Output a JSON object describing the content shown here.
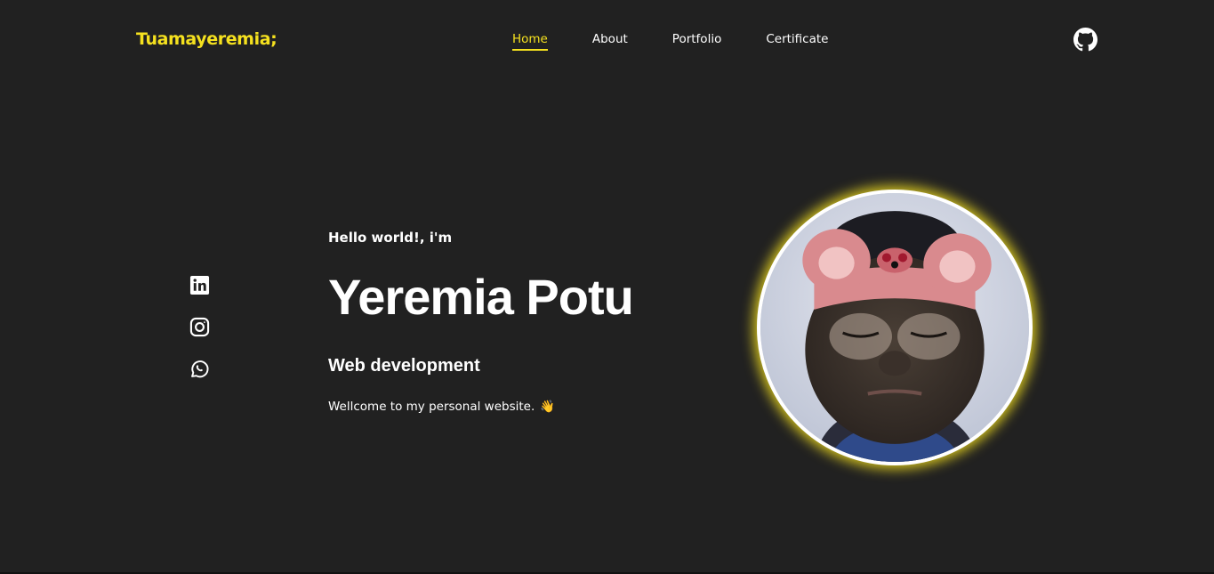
{
  "nav": {
    "brand": "Tuamayeremia;",
    "links": [
      {
        "label": "Home",
        "active": true
      },
      {
        "label": "About",
        "active": false
      },
      {
        "label": "Portfolio",
        "active": false
      },
      {
        "label": "Certificate",
        "active": false
      }
    ],
    "right_icon": "github-icon"
  },
  "socials": [
    "linkedin-icon",
    "instagram-icon",
    "whatsapp-icon"
  ],
  "hero": {
    "greeting": "Hello world!, i'm",
    "name": "Yeremia Potu",
    "role": "Web development",
    "welcome": "Wellcome to my personal website.",
    "wave_emoji": "👋"
  },
  "colors": {
    "background": "#212121",
    "accent": "#f5e11f",
    "text": "#ffffff"
  }
}
